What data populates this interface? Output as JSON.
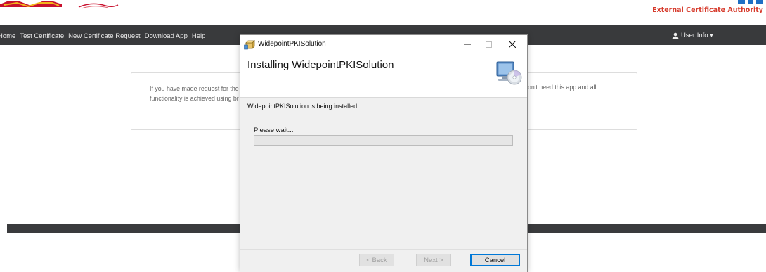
{
  "site": {
    "brand_right": "External Certificate Authority",
    "nav": {
      "items": [
        "Home",
        "Test Certificate",
        "New Certificate Request",
        "Download App",
        "Help"
      ],
      "user_info": "User Info",
      "user_info_caret": "▾"
    },
    "content": {
      "text_left_1": "If you have made request for the",
      "text_left_2": "functionality is achieved using br",
      "text_right_1": "on't need this app and all"
    },
    "colors": {
      "navbar": "#393a3c",
      "brand_accent": "#d63a2b",
      "brand_blue": "#1f6fc4"
    }
  },
  "dialog": {
    "window_title": "WidepointPKISolution",
    "header_title": "Installing WidepointPKISolution",
    "body_text": "WidepointPKISolution is being installed.",
    "wait_label": "Please wait...",
    "progress_fraction": 0,
    "buttons": {
      "back": "< Back",
      "next": "Next >",
      "cancel": "Cancel"
    },
    "icons": {
      "app": "installer-package-icon",
      "header": "computer-cd-install-icon",
      "minimize": "minimize-icon",
      "maximize": "maximize-icon",
      "close": "close-icon"
    }
  }
}
